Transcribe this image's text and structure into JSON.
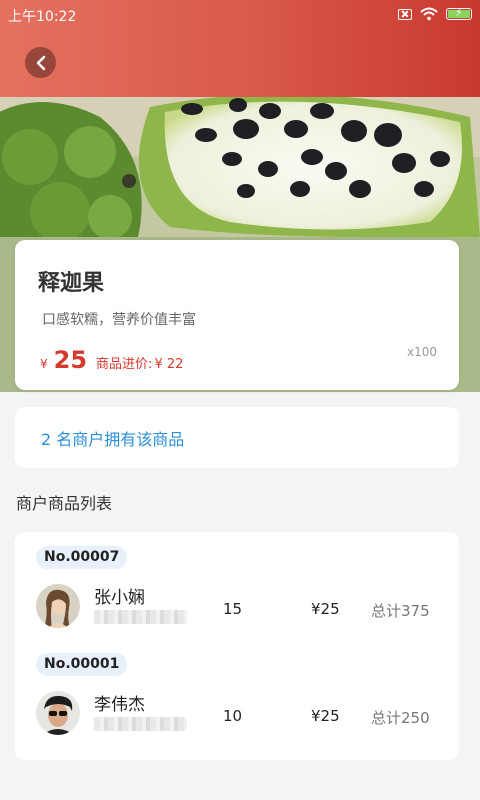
{
  "status": {
    "time": "上午10:22"
  },
  "icons": {
    "back": "chevron-left-icon",
    "wifi": "wifi-icon",
    "sim": "no-sim-icon",
    "battery": "battery-charging-icon"
  },
  "colors": {
    "header_start": "#e4715f",
    "header_end": "#c8392f",
    "price": "#d43a2e",
    "link_blue": "#2b8fd8",
    "badge_bg": "#e8f1fb"
  },
  "product": {
    "name": "释迦果",
    "description": "口感软糯，营养价值丰富",
    "price_symbol": "¥",
    "price": "25",
    "cost_label": "商品进价:",
    "cost_value": "¥ 22",
    "quantity": "x100"
  },
  "merchant_count_text": "2 名商户拥有该商品",
  "section_title": "商户商品列表",
  "merchants": [
    {
      "no": "No.00007",
      "name": "张小娴",
      "quantity": "15",
      "price": "¥25",
      "total": "总计375"
    },
    {
      "no": "No.00001",
      "name": "李伟杰",
      "quantity": "10",
      "price": "¥25",
      "total": "总计250"
    }
  ]
}
